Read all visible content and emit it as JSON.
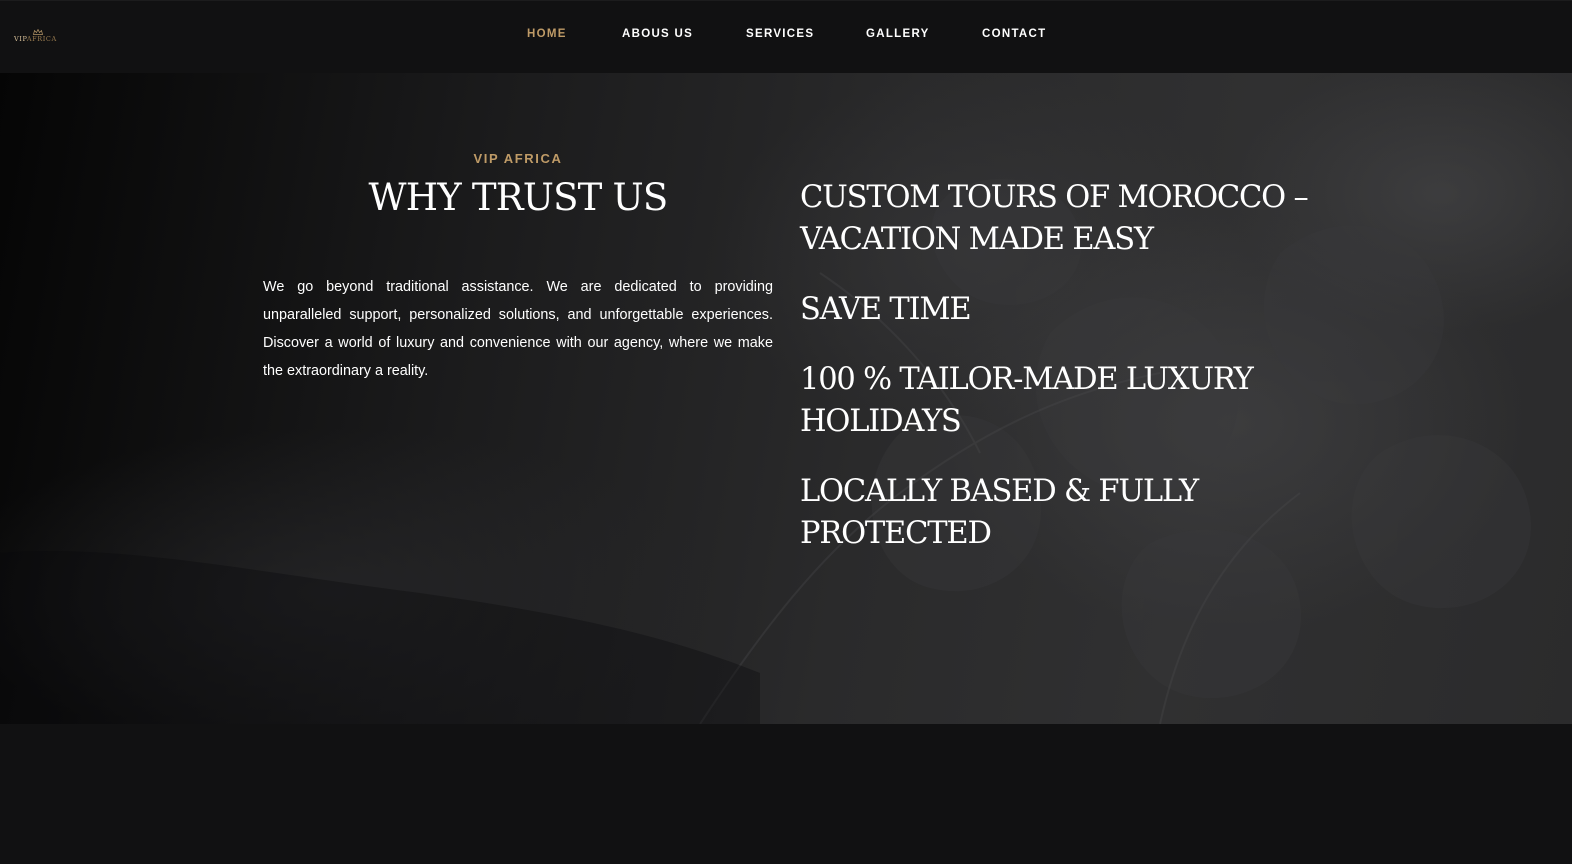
{
  "header": {
    "logo": {
      "icon": "crown-icon",
      "text_part1": "VIP",
      "text_part2": "AFRICA"
    },
    "nav": [
      {
        "label": "HOME",
        "active": true
      },
      {
        "label": "ABOUS US",
        "active": false
      },
      {
        "label": "SERVICES",
        "active": false
      },
      {
        "label": "GALLERY",
        "active": false
      },
      {
        "label": "CONTACT",
        "active": false
      }
    ]
  },
  "hero": {
    "kicker": "VIP AFRICA",
    "title": "WHY TRUST US",
    "body": "We go beyond traditional assistance. We are dedicated to providing unparalleled support, personalized solutions, and unforgettable experiences. Discover a world of luxury and convenience with our agency, where we make the extraordinary a reality.",
    "features": [
      "CUSTOM TOURS OF MOROCCO – VACATION MADE EASY",
      "SAVE TIME",
      "100 % TAILOR-MADE LUXURY HOLIDAYS",
      "LOCALLY BASED & FULLY PROTECTED"
    ]
  },
  "colors": {
    "accent_gold": "#bf9b67",
    "background": "#111112",
    "text": "#ffffff"
  }
}
